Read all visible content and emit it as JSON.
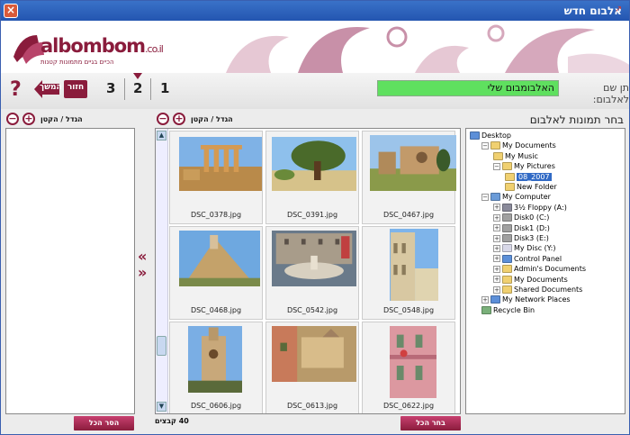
{
  "window": {
    "title": "אלבום חדש",
    "close_symbol": "×",
    "pin_symbol": "↗"
  },
  "header": {
    "logo_brand": "albombom",
    "logo_domain": ".co.il",
    "logo_tagline": "הכיים בגיים מתמונות קטנות"
  },
  "steps": {
    "help_symbol": "?",
    "back_label": "המשך",
    "next_label": "חזור",
    "step1": "1",
    "step2": "2",
    "step3": "3",
    "album_name_label": "תן שם לאלבום:",
    "album_name_value": "האלבומבום שלי"
  },
  "panes": {
    "tree_title": "בחר תמונות לאלבום",
    "zoom_label": "הגדל / הקטן",
    "zoom_in_symbol": "+",
    "zoom_out_symbol": "−",
    "add_arrow": "«",
    "remove_arrow": "»",
    "select_all_label": "בחר הכל",
    "remove_all_label": "הסר הכל",
    "file_count": "40 קבצים"
  },
  "tree": [
    {
      "label": "Desktop",
      "expander": "",
      "icon": "desktop-icon",
      "color": "#5c8fd8"
    },
    {
      "label": "My Documents",
      "expander": "−",
      "icon": "folder-docs-icon",
      "color": "#f0d070"
    },
    {
      "label": "My Music",
      "expander": "",
      "icon": "folder-music-icon",
      "color": "#f0d070"
    },
    {
      "label": "My Pictures",
      "expander": "−",
      "icon": "folder-pictures-icon",
      "color": "#f0d070"
    },
    {
      "label": "08_2007",
      "expander": "",
      "icon": "folder-open-icon",
      "color": "#f0d070",
      "selected": true
    },
    {
      "label": "New Folder",
      "expander": "",
      "icon": "folder-icon",
      "color": "#f0d070"
    },
    {
      "label": "My Computer",
      "expander": "−",
      "icon": "computer-icon",
      "color": "#6a9bd8"
    },
    {
      "label": "3½ Floppy (A:)",
      "expander": "+",
      "icon": "floppy-icon",
      "color": "#8a8a9a"
    },
    {
      "label": "Disk0 (C:)",
      "expander": "+",
      "icon": "drive-icon",
      "color": "#a0a0a0"
    },
    {
      "label": "Disk1 (D:)",
      "expander": "+",
      "icon": "drive-icon",
      "color": "#a0a0a0"
    },
    {
      "label": "Disk3 (E:)",
      "expander": "+",
      "icon": "drive-icon",
      "color": "#a0a0a0"
    },
    {
      "label": "My Disc (Y:)",
      "expander": "+",
      "icon": "cd-icon",
      "color": "#d8d8e8"
    },
    {
      "label": "Control Panel",
      "expander": "+",
      "icon": "control-panel-icon",
      "color": "#5c8fd8"
    },
    {
      "label": "Admin's Documents",
      "expander": "+",
      "icon": "folder-icon",
      "color": "#f0d070"
    },
    {
      "label": "My Documents",
      "expander": "+",
      "icon": "folder-icon",
      "color": "#f0d070"
    },
    {
      "label": "Shared Documents",
      "expander": "+",
      "icon": "folder-icon",
      "color": "#f0d070"
    },
    {
      "label": "My Network Places",
      "expander": "+",
      "icon": "network-icon",
      "color": "#5c8fd8"
    },
    {
      "label": "Recycle Bin",
      "expander": "",
      "icon": "recycle-bin-icon",
      "color": "#7ab07a"
    }
  ],
  "thumbnails": [
    {
      "caption": "DSC_0378.jpg",
      "scene": "temple-ruins"
    },
    {
      "caption": "DSC_0391.jpg",
      "scene": "olive-tree"
    },
    {
      "caption": "DSC_0467.jpg",
      "scene": "church-ruins"
    },
    {
      "caption": "DSC_0468.jpg",
      "scene": "rock-building"
    },
    {
      "caption": "DSC_0542.jpg",
      "scene": "fountain-square"
    },
    {
      "caption": "DSC_0548.jpg",
      "scene": "palazzo"
    },
    {
      "caption": "DSC_0606.jpg",
      "scene": "cathedral"
    },
    {
      "caption": "DSC_0613.jpg",
      "scene": "stone-houses"
    },
    {
      "caption": "DSC_0622.jpg",
      "scene": "pink-facade"
    }
  ],
  "colors": {
    "brand": "#8a1c3c",
    "titlebar": "#2d62bc",
    "album_name_bg": "#5fe05f",
    "selection": "#316ac5"
  }
}
